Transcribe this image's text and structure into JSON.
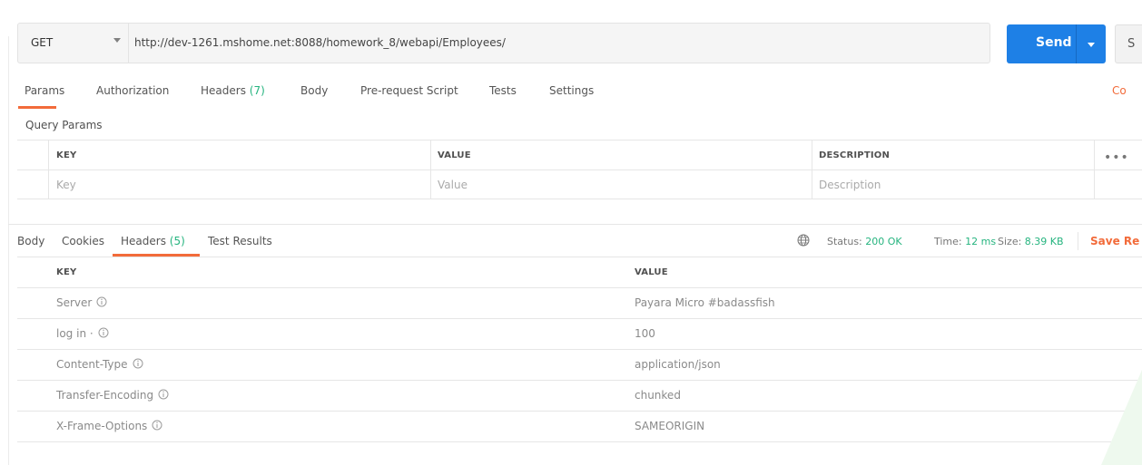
{
  "request": {
    "method": "GET",
    "url": "http://dev-1261.mshome.net:8088/homework_8/webapi/Employees/",
    "send_label": "Send",
    "save_label": "S"
  },
  "request_tabs": [
    {
      "label": "Params"
    },
    {
      "label": "Authorization"
    },
    {
      "label": "Headers",
      "count": "(7)"
    },
    {
      "label": "Body"
    },
    {
      "label": "Pre-request Script"
    },
    {
      "label": "Tests"
    },
    {
      "label": "Settings"
    }
  ],
  "cookies_link": "Co",
  "query_params": {
    "title": "Query Params",
    "columns": [
      "KEY",
      "VALUE",
      "DESCRIPTION"
    ],
    "placeholders": [
      "Key",
      "Value",
      "Description"
    ]
  },
  "response_tabs": [
    {
      "label": "Body"
    },
    {
      "label": "Cookies"
    },
    {
      "label": "Headers",
      "count": "(5)"
    },
    {
      "label": "Test Results"
    }
  ],
  "response_status": {
    "status_label": "Status:",
    "status_value": "200 OK",
    "time_label": "Time:",
    "time_value": "12 ms",
    "size_label": "Size:",
    "size_value": "8.39 KB",
    "save_label": "Save Re"
  },
  "response_headers": {
    "columns": [
      "KEY",
      "VALUE"
    ],
    "rows": [
      {
        "key": "Server",
        "value": "Payara Micro #badassfish"
      },
      {
        "key": "log in ·",
        "value": "100"
      },
      {
        "key": "Content-Type",
        "value": "application/json"
      },
      {
        "key": "Transfer-Encoding",
        "value": "chunked"
      },
      {
        "key": "X-Frame-Options",
        "value": "SAMEORIGIN"
      }
    ]
  },
  "colors": {
    "accent": "#f26b3a",
    "send": "#1e80e6",
    "success": "#26b47f"
  }
}
